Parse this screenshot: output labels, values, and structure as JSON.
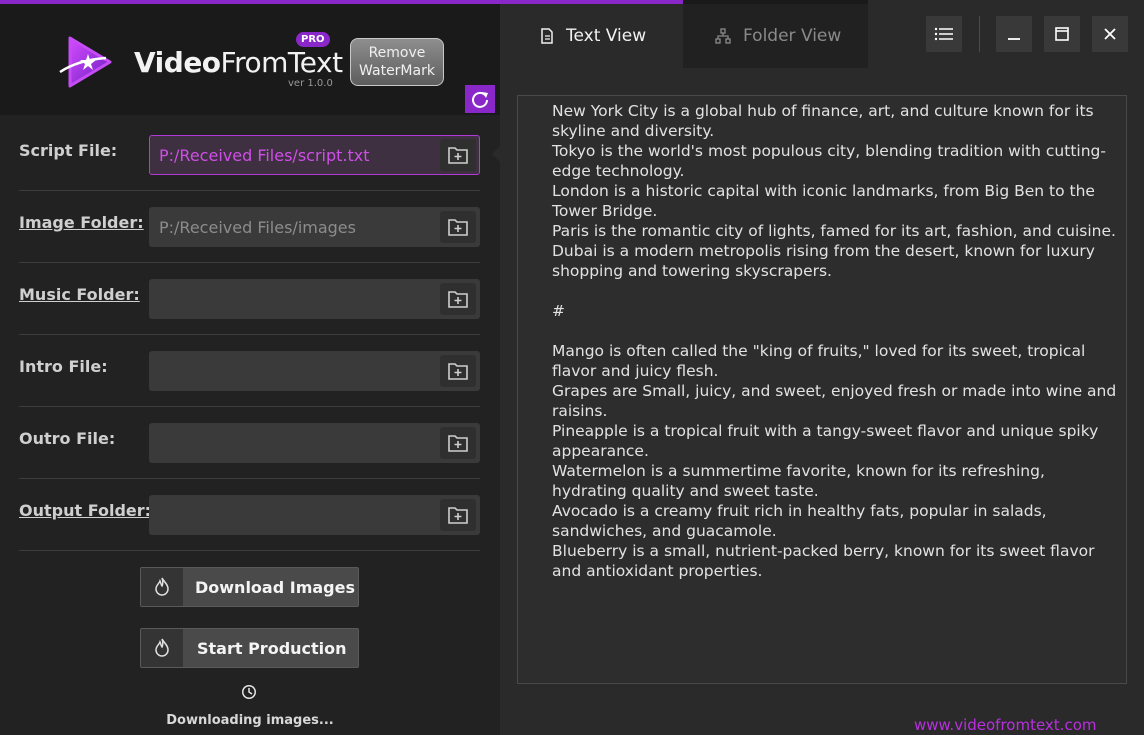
{
  "app": {
    "brand_bold": "Video",
    "brand_light": "FromText",
    "badge": "PRO",
    "version": "ver 1.0.0",
    "remove_watermark_line1": "Remove",
    "remove_watermark_line2": "WaterMark",
    "accent_color": "#8a27c9"
  },
  "fields": [
    {
      "label": "Script File:",
      "value": "P:/Received Files/script.txt"
    },
    {
      "label": "Image Folder:",
      "value": "P:/Received Files/images"
    },
    {
      "label": "Music Folder:",
      "value": ""
    },
    {
      "label": "Intro File:",
      "value": ""
    },
    {
      "label": "Outro File:",
      "value": ""
    },
    {
      "label": "Output Folder:",
      "value": ""
    }
  ],
  "actions": {
    "download_images": "Download Images",
    "start_production": "Start Production"
  },
  "status_text": "Downloading images...",
  "tabs": {
    "text_view": "Text View",
    "folder_view": "Folder View"
  },
  "script_lines": [
    "New York City is a global hub of finance, art, and culture known for its",
    "skyline and diversity.",
    "Tokyo is the world's most populous city, blending tradition with cutting-",
    "edge technology.",
    "London is a historic capital with iconic landmarks, from Big Ben to the",
    "Tower Bridge.",
    "Paris is the romantic city of lights, famed for its art, fashion, and cuisine.",
    "Dubai is a modern metropolis rising from the desert, known for luxury",
    "shopping and towering skyscrapers.",
    "",
    "#",
    "",
    "Mango is often called the \"king of fruits,\" loved for its sweet, tropical",
    "flavor and juicy flesh.",
    "Grapes are Small, juicy, and sweet, enjoyed fresh or made into wine and",
    "raisins.",
    "Pineapple is a tropical fruit with a tangy-sweet flavor and unique spiky",
    "appearance.",
    "Watermelon is a summertime favorite, known for its refreshing,",
    "hydrating quality and sweet taste.",
    "Avocado is a creamy fruit rich in healthy fats, popular in salads,",
    "sandwiches, and guacamole.",
    "Blueberry is a small, nutrient-packed berry, known for its sweet flavor",
    "and antioxidant properties."
  ],
  "website": "www.videofromtext.com"
}
